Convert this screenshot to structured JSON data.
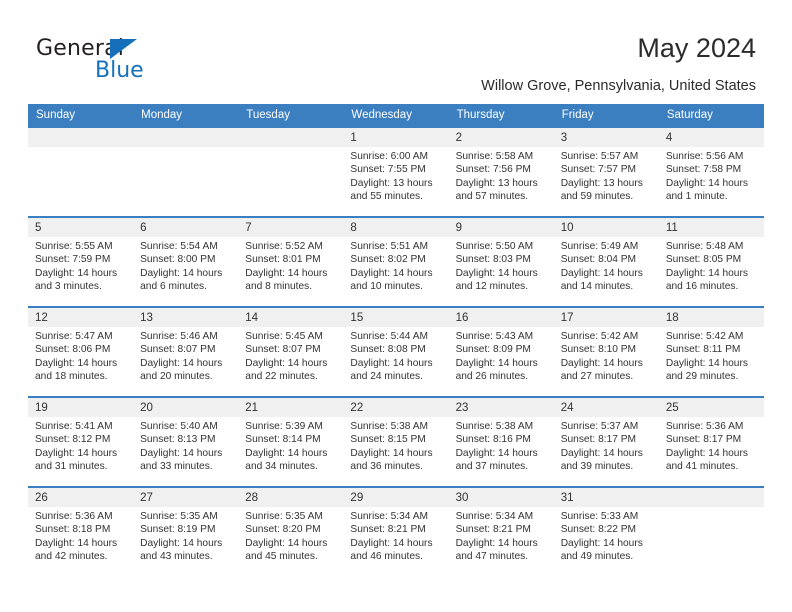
{
  "brand": {
    "name_top": "General",
    "name_bottom": "Blue",
    "accent_color": "#1673bb"
  },
  "header": {
    "title": "May 2024",
    "subtitle": "Willow Grove, Pennsylvania, United States",
    "header_bg": "#3c7fc1",
    "daynum_bg": "#f0f0f0"
  },
  "weekdays": [
    "Sunday",
    "Monday",
    "Tuesday",
    "Wednesday",
    "Thursday",
    "Friday",
    "Saturday"
  ],
  "labels": {
    "sunrise_prefix": "Sunrise:",
    "sunset_prefix": "Sunset:",
    "daylight_prefix": "Daylight:"
  },
  "calendar": {
    "weeks": [
      [
        {
          "day": "",
          "empty": true
        },
        {
          "day": "",
          "empty": true
        },
        {
          "day": "",
          "empty": true
        },
        {
          "day": "1",
          "sunrise": "Sunrise: 6:00 AM",
          "sunset": "Sunset: 7:55 PM",
          "daylight1": "Daylight: 13 hours",
          "daylight2": "and 55 minutes."
        },
        {
          "day": "2",
          "sunrise": "Sunrise: 5:58 AM",
          "sunset": "Sunset: 7:56 PM",
          "daylight1": "Daylight: 13 hours",
          "daylight2": "and 57 minutes."
        },
        {
          "day": "3",
          "sunrise": "Sunrise: 5:57 AM",
          "sunset": "Sunset: 7:57 PM",
          "daylight1": "Daylight: 13 hours",
          "daylight2": "and 59 minutes."
        },
        {
          "day": "4",
          "sunrise": "Sunrise: 5:56 AM",
          "sunset": "Sunset: 7:58 PM",
          "daylight1": "Daylight: 14 hours",
          "daylight2": "and 1 minute."
        }
      ],
      [
        {
          "day": "5",
          "sunrise": "Sunrise: 5:55 AM",
          "sunset": "Sunset: 7:59 PM",
          "daylight1": "Daylight: 14 hours",
          "daylight2": "and 3 minutes."
        },
        {
          "day": "6",
          "sunrise": "Sunrise: 5:54 AM",
          "sunset": "Sunset: 8:00 PM",
          "daylight1": "Daylight: 14 hours",
          "daylight2": "and 6 minutes."
        },
        {
          "day": "7",
          "sunrise": "Sunrise: 5:52 AM",
          "sunset": "Sunset: 8:01 PM",
          "daylight1": "Daylight: 14 hours",
          "daylight2": "and 8 minutes."
        },
        {
          "day": "8",
          "sunrise": "Sunrise: 5:51 AM",
          "sunset": "Sunset: 8:02 PM",
          "daylight1": "Daylight: 14 hours",
          "daylight2": "and 10 minutes."
        },
        {
          "day": "9",
          "sunrise": "Sunrise: 5:50 AM",
          "sunset": "Sunset: 8:03 PM",
          "daylight1": "Daylight: 14 hours",
          "daylight2": "and 12 minutes."
        },
        {
          "day": "10",
          "sunrise": "Sunrise: 5:49 AM",
          "sunset": "Sunset: 8:04 PM",
          "daylight1": "Daylight: 14 hours",
          "daylight2": "and 14 minutes."
        },
        {
          "day": "11",
          "sunrise": "Sunrise: 5:48 AM",
          "sunset": "Sunset: 8:05 PM",
          "daylight1": "Daylight: 14 hours",
          "daylight2": "and 16 minutes."
        }
      ],
      [
        {
          "day": "12",
          "sunrise": "Sunrise: 5:47 AM",
          "sunset": "Sunset: 8:06 PM",
          "daylight1": "Daylight: 14 hours",
          "daylight2": "and 18 minutes."
        },
        {
          "day": "13",
          "sunrise": "Sunrise: 5:46 AM",
          "sunset": "Sunset: 8:07 PM",
          "daylight1": "Daylight: 14 hours",
          "daylight2": "and 20 minutes."
        },
        {
          "day": "14",
          "sunrise": "Sunrise: 5:45 AM",
          "sunset": "Sunset: 8:07 PM",
          "daylight1": "Daylight: 14 hours",
          "daylight2": "and 22 minutes."
        },
        {
          "day": "15",
          "sunrise": "Sunrise: 5:44 AM",
          "sunset": "Sunset: 8:08 PM",
          "daylight1": "Daylight: 14 hours",
          "daylight2": "and 24 minutes."
        },
        {
          "day": "16",
          "sunrise": "Sunrise: 5:43 AM",
          "sunset": "Sunset: 8:09 PM",
          "daylight1": "Daylight: 14 hours",
          "daylight2": "and 26 minutes."
        },
        {
          "day": "17",
          "sunrise": "Sunrise: 5:42 AM",
          "sunset": "Sunset: 8:10 PM",
          "daylight1": "Daylight: 14 hours",
          "daylight2": "and 27 minutes."
        },
        {
          "day": "18",
          "sunrise": "Sunrise: 5:42 AM",
          "sunset": "Sunset: 8:11 PM",
          "daylight1": "Daylight: 14 hours",
          "daylight2": "and 29 minutes."
        }
      ],
      [
        {
          "day": "19",
          "sunrise": "Sunrise: 5:41 AM",
          "sunset": "Sunset: 8:12 PM",
          "daylight1": "Daylight: 14 hours",
          "daylight2": "and 31 minutes."
        },
        {
          "day": "20",
          "sunrise": "Sunrise: 5:40 AM",
          "sunset": "Sunset: 8:13 PM",
          "daylight1": "Daylight: 14 hours",
          "daylight2": "and 33 minutes."
        },
        {
          "day": "21",
          "sunrise": "Sunrise: 5:39 AM",
          "sunset": "Sunset: 8:14 PM",
          "daylight1": "Daylight: 14 hours",
          "daylight2": "and 34 minutes."
        },
        {
          "day": "22",
          "sunrise": "Sunrise: 5:38 AM",
          "sunset": "Sunset: 8:15 PM",
          "daylight1": "Daylight: 14 hours",
          "daylight2": "and 36 minutes."
        },
        {
          "day": "23",
          "sunrise": "Sunrise: 5:38 AM",
          "sunset": "Sunset: 8:16 PM",
          "daylight1": "Daylight: 14 hours",
          "daylight2": "and 37 minutes."
        },
        {
          "day": "24",
          "sunrise": "Sunrise: 5:37 AM",
          "sunset": "Sunset: 8:17 PM",
          "daylight1": "Daylight: 14 hours",
          "daylight2": "and 39 minutes."
        },
        {
          "day": "25",
          "sunrise": "Sunrise: 5:36 AM",
          "sunset": "Sunset: 8:17 PM",
          "daylight1": "Daylight: 14 hours",
          "daylight2": "and 41 minutes."
        }
      ],
      [
        {
          "day": "26",
          "sunrise": "Sunrise: 5:36 AM",
          "sunset": "Sunset: 8:18 PM",
          "daylight1": "Daylight: 14 hours",
          "daylight2": "and 42 minutes."
        },
        {
          "day": "27",
          "sunrise": "Sunrise: 5:35 AM",
          "sunset": "Sunset: 8:19 PM",
          "daylight1": "Daylight: 14 hours",
          "daylight2": "and 43 minutes."
        },
        {
          "day": "28",
          "sunrise": "Sunrise: 5:35 AM",
          "sunset": "Sunset: 8:20 PM",
          "daylight1": "Daylight: 14 hours",
          "daylight2": "and 45 minutes."
        },
        {
          "day": "29",
          "sunrise": "Sunrise: 5:34 AM",
          "sunset": "Sunset: 8:21 PM",
          "daylight1": "Daylight: 14 hours",
          "daylight2": "and 46 minutes."
        },
        {
          "day": "30",
          "sunrise": "Sunrise: 5:34 AM",
          "sunset": "Sunset: 8:21 PM",
          "daylight1": "Daylight: 14 hours",
          "daylight2": "and 47 minutes."
        },
        {
          "day": "31",
          "sunrise": "Sunrise: 5:33 AM",
          "sunset": "Sunset: 8:22 PM",
          "daylight1": "Daylight: 14 hours",
          "daylight2": "and 49 minutes."
        },
        {
          "day": "",
          "empty": true
        }
      ]
    ]
  }
}
